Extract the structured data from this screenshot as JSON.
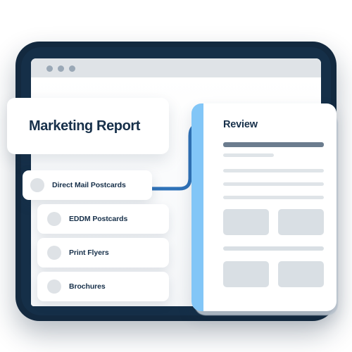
{
  "window": {
    "traffic_lights": [
      "window-dot-close",
      "window-dot-minimize",
      "window-dot-maximize"
    ]
  },
  "report_card": {
    "title": "Marketing Report"
  },
  "options": {
    "primary": {
      "label": "Direct Mail Postcards",
      "bullet_icon": "radio-bullet-icon"
    },
    "items": [
      {
        "label": "EDDM Postcards",
        "bullet_icon": "radio-bullet-icon"
      },
      {
        "label": "Print Flyers",
        "bullet_icon": "radio-bullet-icon"
      },
      {
        "label": "Brochures",
        "bullet_icon": "radio-bullet-icon"
      }
    ]
  },
  "review_panel": {
    "title": "Review",
    "accent_color": "#82c6f7",
    "placeholder_rows": [
      {
        "kind": "heading-bar",
        "width_pct": 100
      },
      {
        "kind": "short-bar",
        "width_pct": 50
      },
      {
        "kind": "line-bar",
        "width_pct": 100
      },
      {
        "kind": "line-bar",
        "width_pct": 100
      },
      {
        "kind": "line-bar",
        "width_pct": 100
      }
    ],
    "placeholder_boxes_top": [
      "box-top-left",
      "box-top-right"
    ],
    "placeholder_divider": "divider-bar",
    "placeholder_boxes_bottom": [
      "box-bottom-left",
      "box-bottom-right"
    ]
  },
  "connector": {
    "stroke_color": "#2f72b8",
    "stroke_width": 5
  },
  "colors": {
    "frame_dark": "#13293f",
    "titlebar": "#dfe3e7",
    "dot": "#9aa8b6",
    "text_navy": "#17304a",
    "bar_strong": "#6b7c8e",
    "bar_light": "#dfe4e8",
    "box_gray": "#d9dfe4",
    "bullet_gray": "#dee2e6",
    "accent_blue": "#82c6f7",
    "connector_blue": "#2f72b8"
  }
}
